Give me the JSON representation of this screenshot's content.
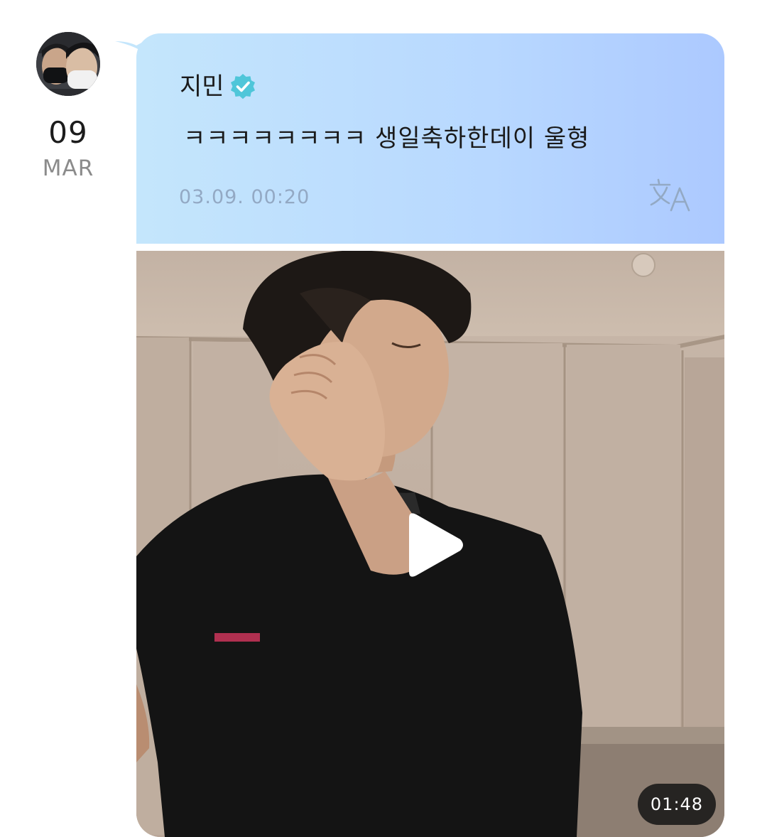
{
  "post": {
    "date": {
      "day": "09",
      "month": "MAR"
    },
    "sender": {
      "name": "지민",
      "verified": true,
      "avatar_icon": "profile-photo"
    },
    "message": "ㅋㅋㅋㅋㅋㅋㅋㅋ 생일축하한데이 울형",
    "timestamp": "03.09. 00:20",
    "translate_icon": "translate-icon",
    "video": {
      "duration": "01:48",
      "play_icon": "play-icon"
    }
  },
  "colors": {
    "bubble_start": "#c4e6fc",
    "bubble_end": "#acc9ff",
    "verified_badge": "#4fc6d9",
    "timestamp": "#93a9c4",
    "duration_badge_bg": "#141414"
  }
}
